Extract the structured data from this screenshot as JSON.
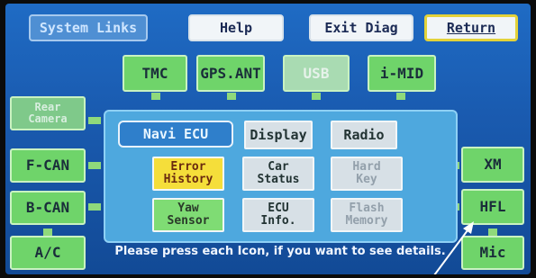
{
  "header": {
    "system_links": "System Links",
    "help": "Help",
    "exit_diag": "Exit Diag",
    "return": "Return"
  },
  "top_row": {
    "tmc": "TMC",
    "gps": "GPS.ANT",
    "usb": "USB",
    "imid": "i-MID"
  },
  "left_col": {
    "rear_camera": "Rear\nCamera",
    "fcan": "F-CAN",
    "bcan": "B-CAN",
    "ac": "A/C"
  },
  "right_col": {
    "xm": "XM",
    "hfl": "HFL",
    "mic": "Mic"
  },
  "panel": {
    "navi_ecu": "Navi ECU",
    "display": "Display",
    "radio": "Radio",
    "error_history": "Error\nHistory",
    "car_status": "Car\nStatus",
    "hard_key": "Hard\nKey",
    "yaw_sensor": "Yaw\nSensor",
    "ecu_info": "ECU\nInfo.",
    "flash_memory": "Flash\nMemory"
  },
  "message": "Please press each Icon, if you want to see details."
}
